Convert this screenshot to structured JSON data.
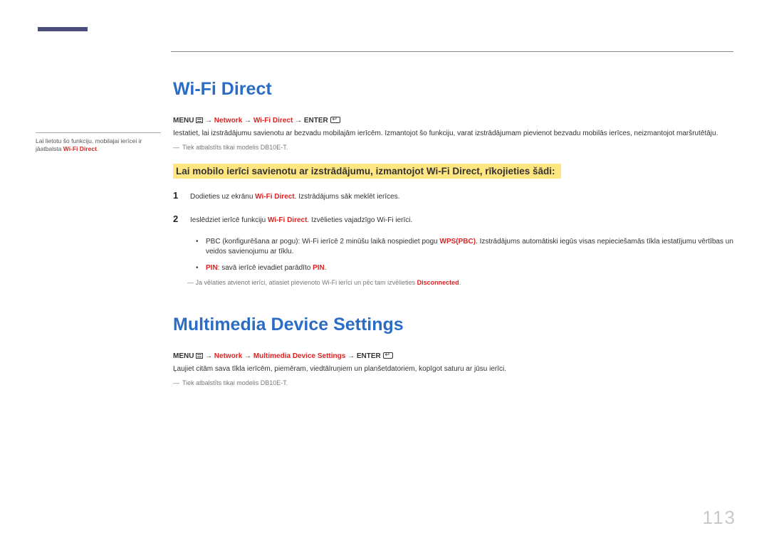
{
  "page_number": "113",
  "sidebar": {
    "note": "Lai lietotu šo funkciju, mobilajai ierīcei ir jāatbalsta ",
    "note_kw": "Wi-Fi Direct",
    "note_end": "."
  },
  "section1": {
    "title": "Wi-Fi Direct",
    "menu_prefix": "MENU",
    "arrow": " → ",
    "network": "Network",
    "target": "Wi-Fi Direct",
    "enter": "ENTER",
    "intro": "Iestatiet, lai izstrādājumu savienotu ar bezvadu mobilajām ierīcēm. Izmantojot šo funkciju, varat izstrādājumam pievienot bezvadu mobilās ierīces, neizmantojot maršrutētāju.",
    "support_note": "Tiek atbalstīts tikai modelis DB10E-T.",
    "highlight": "Lai mobilo ierīci savienotu ar izstrādājumu, izmantojot Wi-Fi Direct, rīkojieties šādi:",
    "step1_num": "1",
    "step1_a": "Dodieties uz ekrānu ",
    "step1_kw": "Wi-Fi Direct",
    "step1_b": ". Izstrādājums sāk meklēt ierīces.",
    "step2_num": "2",
    "step2_a": "Ieslēdziet ierīcē funkciju ",
    "step2_kw": "Wi-Fi Direct",
    "step2_b": ". Izvēlieties vajadzīgo Wi-Fi ierīci.",
    "bullet1_a": "PBC (konfigurēšana ar pogu): Wi-Fi ierīcē 2 minūšu laikā nospiediet pogu ",
    "bullet1_kw": "WPS(PBC)",
    "bullet1_b": ". Izstrādājums automātiski iegūs visas nepieciešamās tīkla iestatījumu vērtības un veidos savienojumu ar tīklu.",
    "bullet2_kw": "PIN",
    "bullet2_a": ": savā ierīcē ievadiet parādīto ",
    "bullet2_kw2": "PIN",
    "bullet2_b": ".",
    "disconnect_a": "Ja vēlaties atvienot ierīci, atlasiet pievienoto Wi-Fi ierīci un pēc tam izvēlieties ",
    "disconnect_kw": "Disconnected",
    "disconnect_b": "."
  },
  "section2": {
    "title": "Multimedia Device Settings",
    "menu_prefix": "MENU",
    "arrow": " → ",
    "network": "Network",
    "target": "Multimedia Device Settings",
    "enter": "ENTER",
    "intro": "Ļaujiet citām sava tīkla ierīcēm, piemēram, viedtālruņiem un planšetdatoriem, kopīgot saturu ar jūsu ierīci.",
    "support_note": "Tiek atbalstīts tikai modelis DB10E-T."
  }
}
